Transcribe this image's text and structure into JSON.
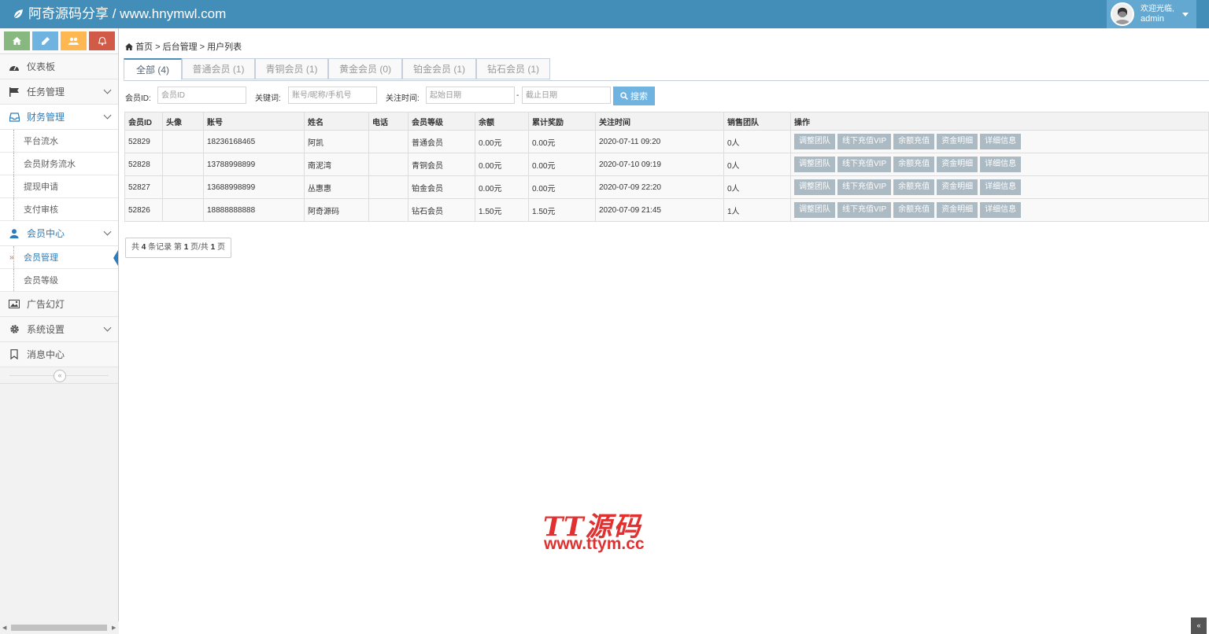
{
  "header": {
    "title": "阿奇源码分享 / www.hnymwl.com",
    "welcome": "欢迎光临,",
    "username": "admin"
  },
  "shortcuts": [
    {
      "icon": "home-icon",
      "color": "#87b87f"
    },
    {
      "icon": "pencil-icon",
      "color": "#6fb3e0"
    },
    {
      "icon": "users-icon",
      "color": "#ffb752"
    },
    {
      "icon": "bell-icon",
      "color": "#d15b47"
    }
  ],
  "sidebar": {
    "dashboard": "仪表板",
    "tasks": "任务管理",
    "finance": "财务管理",
    "finance_items": [
      "平台流水",
      "会员财务流水",
      "提现申请",
      "支付审核"
    ],
    "members": "会员中心",
    "member_items": [
      "会员管理",
      "会员等级"
    ],
    "ads": "广告幻灯",
    "settings": "系统设置",
    "messages": "消息中心"
  },
  "breadcrumb": {
    "home": "首页",
    "sep1": " > ",
    "admin": "后台管理",
    "sep2": " > ",
    "current": "用户列表"
  },
  "tabs": [
    {
      "label": "全部 (4)",
      "active": true
    },
    {
      "label": "普通会员 (1)"
    },
    {
      "label": "青铜会员 (1)"
    },
    {
      "label": "黄金会员 (0)"
    },
    {
      "label": "铂金会员 (1)"
    },
    {
      "label": "钻石会员 (1)"
    }
  ],
  "filters": {
    "member_id_label": "会员ID:",
    "member_id_placeholder": "会员ID",
    "keyword_label": "关键词:",
    "keyword_placeholder": "账号/昵称/手机号",
    "time_label": "关注时间:",
    "start_placeholder": "起始日期",
    "dash": "-",
    "end_placeholder": "截止日期",
    "search_label": "搜索"
  },
  "table": {
    "headers": [
      "会员ID",
      "头像",
      "账号",
      "姓名",
      "电话",
      "会员等级",
      "余额",
      "累计奖励",
      "关注时间",
      "销售团队",
      "操作"
    ],
    "rows": [
      {
        "id": "52829",
        "avatar": "",
        "account": "18236168465",
        "name": "阿凯",
        "phone": "",
        "level": "普通会员",
        "balance": "0.00元",
        "reward": "0.00元",
        "time": "2020-07-11 09:20",
        "team": "0人"
      },
      {
        "id": "52828",
        "avatar": "",
        "account": "13788998899",
        "name": "南泥湾",
        "phone": "",
        "level": "青铜会员",
        "balance": "0.00元",
        "reward": "0.00元",
        "time": "2020-07-10 09:19",
        "team": "0人"
      },
      {
        "id": "52827",
        "avatar": "",
        "account": "13688998899",
        "name": "丛惠惠",
        "phone": "",
        "level": "铂金会员",
        "balance": "0.00元",
        "reward": "0.00元",
        "time": "2020-07-09 22:20",
        "team": "0人"
      },
      {
        "id": "52826",
        "avatar": "",
        "account": "18888888888",
        "name": "阿奇源码",
        "phone": "",
        "level": "钻石会员",
        "balance": "1.50元",
        "reward": "1.50元",
        "time": "2020-07-09 21:45",
        "team": "1人"
      }
    ],
    "actions": [
      "调整团队",
      "线下充值VIP",
      "余额充值",
      "资金明细",
      "详细信息"
    ]
  },
  "pager": {
    "prefix": "共",
    "total": "4",
    "mid": "条记录 第",
    "page": "1",
    "mid2": "页/共",
    "pages": "1",
    "suffix": "页"
  },
  "watermark": {
    "title": "TT源码",
    "url": "www.ttym.cc"
  }
}
